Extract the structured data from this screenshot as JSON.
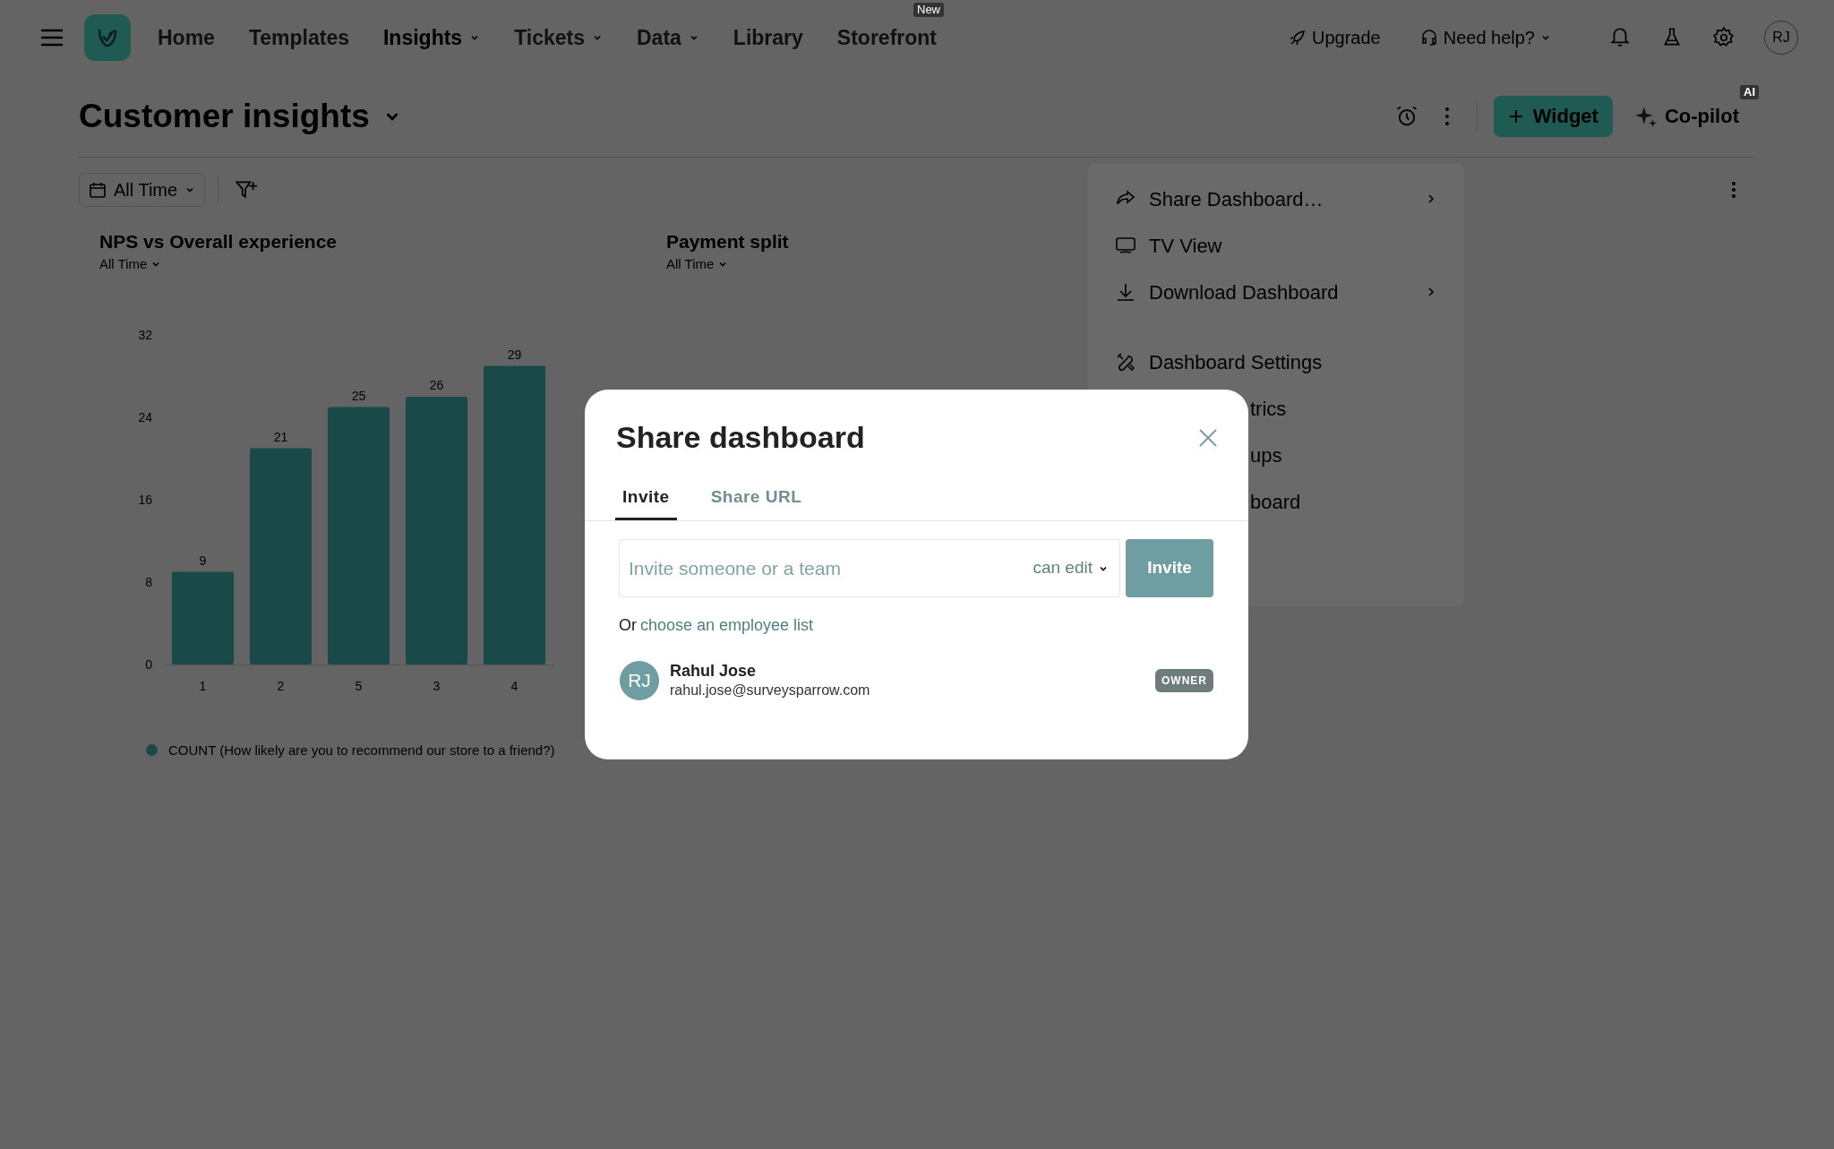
{
  "nav": {
    "items": [
      {
        "label": "Home",
        "selected": false,
        "dropdown": false
      },
      {
        "label": "Templates",
        "selected": false,
        "dropdown": false
      },
      {
        "label": "Insights",
        "selected": true,
        "dropdown": true
      },
      {
        "label": "Tickets",
        "selected": false,
        "dropdown": true
      },
      {
        "label": "Data",
        "selected": false,
        "dropdown": true
      },
      {
        "label": "Library",
        "selected": false,
        "dropdown": false
      },
      {
        "label": "Storefront",
        "selected": false,
        "dropdown": false,
        "badge": "New"
      }
    ],
    "upgrade": "Upgrade",
    "help": "Need help?",
    "avatar": "RJ"
  },
  "header": {
    "title": "Customer insights",
    "widget_button": "Widget",
    "copilot": "Co-pilot",
    "copilot_badge": "AI"
  },
  "filters": {
    "date": "All Time"
  },
  "widgets": [
    {
      "title": "NPS vs Overall experience",
      "range": "All Time",
      "chart_data": {
        "type": "bar",
        "categories": [
          "1",
          "2",
          "5",
          "3",
          "4"
        ],
        "series": [
          {
            "name": "COUNT (How likely are you to recommend our store to a friend?)",
            "color": "#1a4a47",
            "values": [
              9,
              21,
              25,
              26,
              29
            ]
          }
        ],
        "ylim": [
          0,
          32
        ],
        "yticks": [
          0,
          8,
          16,
          24,
          32
        ],
        "data_labels": true
      }
    },
    {
      "title": "Payment split",
      "range": "All Time"
    }
  ],
  "menu": {
    "items": [
      {
        "label": "Share Dashboard…",
        "kind": "share",
        "submenu": true
      },
      {
        "label": "TV View",
        "kind": "tv",
        "submenu": false
      },
      {
        "label": "Download Dashboard",
        "kind": "download",
        "submenu": true
      },
      {
        "label": "Dashboard Settings",
        "kind": "settings",
        "submenu": false
      },
      {
        "label": "trics",
        "kind": "covered",
        "submenu": false
      },
      {
        "label": "ups",
        "kind": "covered",
        "submenu": false
      },
      {
        "label": "board",
        "kind": "covered",
        "submenu": false
      }
    ]
  },
  "modal": {
    "title": "Share dashboard",
    "tabs": [
      {
        "label": "Invite",
        "selected": true
      },
      {
        "label": "Share URL",
        "selected": false
      }
    ],
    "invite_field": {
      "placeholder": "Invite someone or a team"
    },
    "permission": "can edit",
    "invite_button": "Invite",
    "alt_prefix": "Or",
    "alt_link": "choose an employee list",
    "members": [
      {
        "initials": "RJ",
        "name": "Rahul Jose",
        "email": "rahul.jose@surveysparrow.com",
        "role": "OWNER"
      }
    ]
  }
}
